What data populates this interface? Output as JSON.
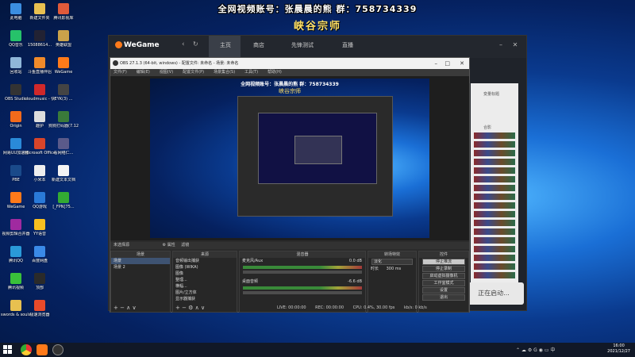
{
  "banner": {
    "line1": "全网视频账号：张晨晨的熊  群：758734339",
    "line2": "峡谷宗师"
  },
  "desktop_icons": [
    {
      "label": "此电脑",
      "col": 0,
      "row": 0,
      "color": "#3b8ee0"
    },
    {
      "label": "新建文件夹",
      "col": 1,
      "row": 0,
      "color": "#e8c050"
    },
    {
      "label": "腾讯影视库",
      "col": 2,
      "row": 0,
      "color": "#e05a3a"
    },
    {
      "label": "QQ音乐",
      "col": 0,
      "row": 1,
      "color": "#26c26a"
    },
    {
      "label": "15088614...",
      "col": 1,
      "row": 1,
      "color": "#223"
    },
    {
      "label": "英雄联盟",
      "col": 2,
      "row": 1,
      "color": "#c9a24a"
    },
    {
      "label": "回收站",
      "col": 0,
      "row": 2,
      "color": "#8fb6d8"
    },
    {
      "label": "斗鱼直播伴侣",
      "col": 1,
      "row": 2,
      "color": "#f08a2a"
    },
    {
      "label": "WeGame",
      "col": 2,
      "row": 2,
      "color": "#ff7a1a"
    },
    {
      "label": "OBS Studio",
      "col": 0,
      "row": 3,
      "color": "#333"
    },
    {
      "label": "cloudmusic - 快捷方式",
      "col": 1,
      "row": 3,
      "color": "#d0282a"
    },
    {
      "label": "EYK(3) ...",
      "col": 2,
      "row": 3,
      "color": "#444"
    },
    {
      "label": "Origin",
      "col": 0,
      "row": 4,
      "color": "#f26a1b"
    },
    {
      "label": "趣护",
      "col": 1,
      "row": 4,
      "color": "#ddd"
    },
    {
      "label": "狗狗打码器(7.12修改)",
      "col": 2,
      "row": 4,
      "color": "#3a7a3a"
    },
    {
      "label": "网易UU加速器",
      "col": 0,
      "row": 5,
      "color": "#2a8ad8"
    },
    {
      "label": "Microsoft Office",
      "col": 1,
      "row": 5,
      "color": "#d8452a"
    },
    {
      "label": "看网络仁...",
      "col": 2,
      "row": 5,
      "color": "#5a5a8a"
    },
    {
      "label": "PBE",
      "col": 0,
      "row": 6,
      "color": "#1a4a8a"
    },
    {
      "label": "小米本",
      "col": 1,
      "row": 6,
      "color": "#eee"
    },
    {
      "label": "新建文本文档",
      "col": 2,
      "row": 6,
      "color": "#f4f4f4"
    },
    {
      "label": "WeGame",
      "col": 0,
      "row": 7,
      "color": "#ff7a1a"
    },
    {
      "label": "QQ游戏",
      "col": 1,
      "row": 7,
      "color": "#2a7ad8"
    },
    {
      "label": "[_FPN]75...",
      "col": 2,
      "row": 7,
      "color": "#3a3"
    },
    {
      "label": "视频剪辑合并器",
      "col": 0,
      "row": 8,
      "color": "#a02aa0"
    },
    {
      "label": "YY语音",
      "col": 1,
      "row": 8,
      "color": "#f8c020"
    },
    {
      "label": "腾讯QQ",
      "col": 0,
      "row": 9,
      "color": "#2a9ad8"
    },
    {
      "label": "百度网盘",
      "col": 1,
      "row": 9,
      "color": "#3a8ae8"
    },
    {
      "label": "腾讯视频",
      "col": 0,
      "row": 10,
      "color": "#3ac03a"
    },
    {
      "label": "顶部",
      "col": 1,
      "row": 10,
      "color": "#2a2a2a"
    },
    {
      "label": "swords & souls ne...",
      "col": 0,
      "row": 11,
      "color": "#e8c050"
    },
    {
      "label": "极速浏览器",
      "col": 1,
      "row": 11,
      "color": "#e84a2a"
    }
  ],
  "wegame": {
    "logo": "WeGame",
    "nav_home": "主页",
    "nav_store": "商店",
    "nav_test": "先锋测试",
    "nav_live": "直播",
    "side_title1": "",
    "side_title2": "变量标题",
    "side_title3": "合影",
    "start_button": "正在启动..."
  },
  "obs": {
    "title": "OBS 27.1.3 (64-bit, windows) - 配置文件: 未命名 - 场景: 未命名",
    "menu": [
      "文件(F)",
      "编辑(E)",
      "视图(V)",
      "配置文件(P)",
      "场景集合(S)",
      "工具(T)",
      "帮助(H)"
    ],
    "nested_line1": "全网视频账号：张晨晨的熊  群：758734339",
    "nested_line2": "峡谷宗师",
    "dock_label": "未选择源",
    "dock_props": "属性",
    "dock_filters": "滤镜",
    "scenes_header": "场景",
    "scenes": [
      "场景",
      "场景 2"
    ],
    "sources_header": "来源",
    "sources": [
      "音频输出捕获",
      "图像 (WIKA)",
      "图像",
      "整理...",
      "横幅...",
      "图片/立方体",
      "显示器捕获"
    ],
    "mixer_header": "混音器",
    "mixer": [
      {
        "name": "麦克风/Aux",
        "db": "0.0 dB"
      },
      {
        "name": "桌面音频",
        "db": "-6.6 dB"
      }
    ],
    "transition_header": "转场特效",
    "transition": "淡化",
    "duration_label": "时长",
    "duration_value": "300 ms",
    "controls_header": "控件",
    "controls": [
      "停止推流",
      "停止录制",
      "启动虚拟摄像机",
      "工作室模式",
      "设置",
      "退出"
    ],
    "status": [
      "LIVE: 00:00:00",
      "REC: 00:00:00",
      "CPU: 0.4%, 30.00 fps",
      "kb/s: 0 kb/s"
    ]
  },
  "taskbar": {
    "time": "16:00",
    "date": "2021/12/27"
  }
}
